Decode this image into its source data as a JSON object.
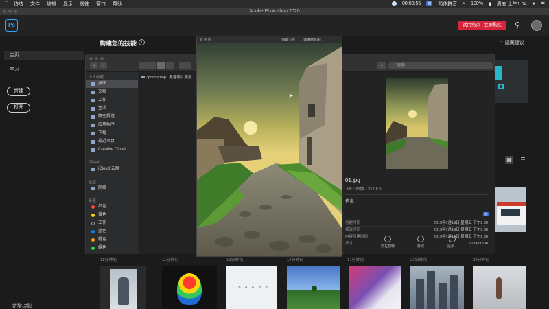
{
  "menubar": {
    "items": [
      "访达",
      "文件",
      "编辑",
      "显示",
      "前往",
      "窗口",
      "帮助"
    ],
    "recording_time": "00:00:55",
    "input_method": "简体拼音",
    "battery": "100%",
    "clock": "周五 上午1:04"
  },
  "window_title": "Adobe Photoshop 2020",
  "header": {
    "logo": "Ps",
    "trial_text": "试用结束",
    "buy_now": "立即购买"
  },
  "sidebar": {
    "home": "主页",
    "learn": "学习",
    "new_button": "新建",
    "open_button": "打开",
    "whats_new": "新增功能"
  },
  "main": {
    "title": "构建您的技能",
    "hide_tips": "隐藏建议",
    "recent_labels": [
      "11分钟前",
      "11分钟前",
      "13分钟前",
      "14分钟前",
      "17分钟前",
      "23分钟前",
      "28分钟前"
    ]
  },
  "finder": {
    "search_placeholder": "搜索",
    "section_personal": "个人收藏",
    "favorites": [
      "桌面",
      "文稿",
      "工作",
      "生活",
      "隔空投送",
      "应用程序",
      "下载",
      "最近项目",
      "Creative Cloud..."
    ],
    "section_icloud": "iCloud",
    "icloud_items": [
      "iCloud 云盘"
    ],
    "section_location": "位置",
    "location_items": [
      "网络"
    ],
    "section_tags": "标签",
    "tags": [
      {
        "name": "红色",
        "color": "#ff453a"
      },
      {
        "name": "黄色",
        "color": "#ffd60a"
      },
      {
        "name": "工作",
        "color": "transparent"
      },
      {
        "name": "蓝色",
        "color": "#0a84ff"
      },
      {
        "name": "橙色",
        "color": "#ff9f0a"
      },
      {
        "name": "绿色",
        "color": "#32d74b"
      }
    ],
    "file_name": "3photoshop...戴着照片满足",
    "preview": {
      "name": "01.jpg",
      "type": "JPEG图像 - 327 KB",
      "info_label": "信息",
      "hide_label": "隐",
      "rows": [
        {
          "k": "创建时间",
          "v": "2019年7月19日 星期五 下午9:00"
        },
        {
          "k": "修改时间",
          "v": "2019年7月19日 星期五 下午9:00"
        },
        {
          "k": "内容创建时间",
          "v": "2019年7月19日 星期五 下午9:00"
        },
        {
          "k": "尺寸",
          "v": "1024×1508"
        }
      ],
      "actions": [
        "向左旋转",
        "标记",
        "更多..."
      ]
    }
  },
  "image_window": {
    "controls": [
      "全屏",
      "用\"预览\"打开"
    ]
  }
}
